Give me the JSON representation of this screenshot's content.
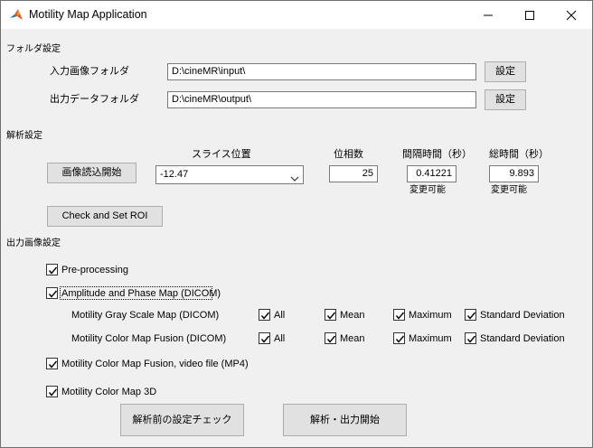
{
  "window": {
    "title": "Motility Map Application",
    "controls": [
      "minimize",
      "maximize",
      "close"
    ]
  },
  "folder_settings": {
    "heading": "フォルダ設定",
    "input_label": "入力画像フォルダ",
    "input_value": "D:\\cineMR\\input\\",
    "input_button": "設定",
    "output_label": "出力データフォルダ",
    "output_value": "D:\\cineMR\\output\\",
    "output_button": "設定"
  },
  "analysis_settings": {
    "heading": "解析設定",
    "load_button": "画像読込開始",
    "slice_label": "スライス位置",
    "slice_value": "-12.47",
    "phase_label": "位相数",
    "phase_value": "25",
    "interval_label": "間隔時間（秒）",
    "interval_value": "0.41221",
    "interval_note": "変更可能",
    "total_label": "総時間（秒）",
    "total_value": "9.893",
    "total_note": "変更可能",
    "roi_button": "Check and Set ROI"
  },
  "output_settings": {
    "heading": "出力画像設定",
    "preprocessing": {
      "label": "Pre-processing",
      "checked": true
    },
    "amplitude": {
      "label": "Amplitude and Phase Map (DICOM)",
      "checked": true
    },
    "gray_row": {
      "label": "Motility Gray Scale Map (DICOM)",
      "all": "All",
      "mean": "Mean",
      "maximum": "Maximum",
      "std": "Standard Deviation",
      "checked": [
        true,
        true,
        true,
        true
      ]
    },
    "color_row": {
      "label": "Motility Color Map Fusion (DICOM)",
      "all": "All",
      "mean": "Mean",
      "maximum": "Maximum",
      "std": "Standard Deviation",
      "checked": [
        true,
        true,
        true,
        true
      ]
    },
    "video": {
      "label": "Motility Color Map Fusion, video file (MP4)",
      "checked": true
    },
    "map3d": {
      "label": "Motility Color Map 3D",
      "checked": true
    }
  },
  "actions": {
    "check_button": "解析前の設定チェック",
    "start_button": "解析・出力開始"
  },
  "icons": [
    "matlab-icon",
    "minimize-icon",
    "maximize-icon",
    "close-icon",
    "chevron-down-icon",
    "checkmark-icon"
  ]
}
